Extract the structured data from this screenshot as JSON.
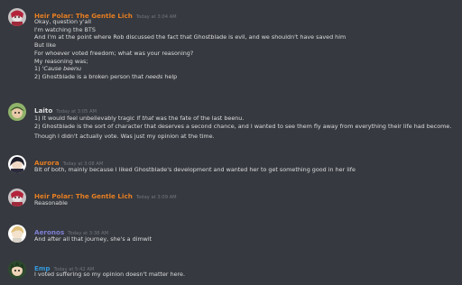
{
  "messages": [
    {
      "author": "Heir Polar: The Gentle Lich",
      "color": "#e67e22",
      "timestamp": "Today at 3:04 AM",
      "lines": [
        "Okay, question y'all",
        "I'm watching the BTS",
        "And I'm at the point where Rob discussed the fact that Ghostblade is evil, and we shouldn't have saved him",
        "But like",
        "For whoever voted freedom; what was your reasoning?",
        "My reasoning was;",
        "1) 'Cause beenu",
        "2) Ghostblade is a broken person that needs help"
      ]
    },
    {
      "author": "Laito",
      "color": "#dcddde",
      "timestamp": "Today at 3:05 AM",
      "lines": [
        "1) It would feel unbelievably tragic if that was the fate of the last beenu.",
        "2) Ghostblade is the sort of character that deserves a second chance, and I wanted to see them fly away from everything their life had become.",
        "Though I didn't actually vote. Was just my opinion at the time."
      ]
    },
    {
      "author": "Aurora",
      "color": "#e67e22",
      "timestamp": "Today at 3:08 AM",
      "lines": [
        "Bit of both, mainly because I liked Ghostblade's development and wanted her to get something good in her life"
      ]
    },
    {
      "author": "Heir Polar: The Gentle Lich",
      "color": "#e67e22",
      "timestamp": "Today at 3:09 AM",
      "lines": [
        "Reasonable"
      ]
    },
    {
      "author": "Aeronos",
      "color": "#7e7fd4",
      "timestamp": "Today at 3:38 AM",
      "lines": [
        "And after all that journey, she's a dimwit"
      ]
    },
    {
      "author": "Emp",
      "color": "#3498db",
      "timestamp": "Today at 5:42 AM",
      "lines": [
        "I voted suffering so my opinion doesn't matter here."
      ]
    }
  ]
}
